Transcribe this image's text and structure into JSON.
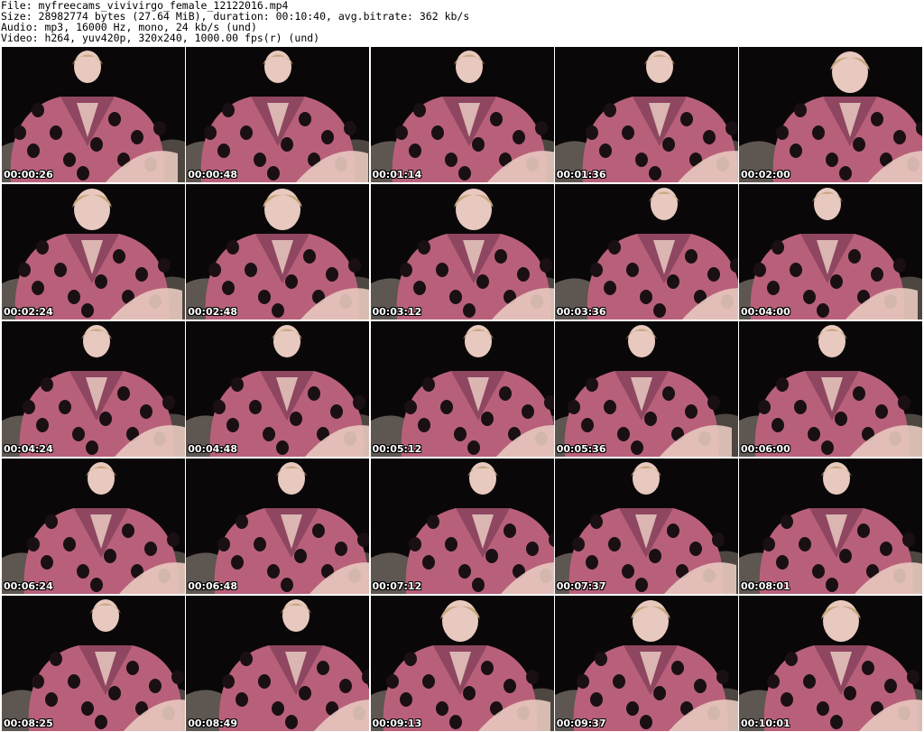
{
  "header": {
    "file_line": "File: myfreecams_vivivirgo_female_12122016.mp4",
    "size_line": "Size: 28982774 bytes (27.64 MiB), duration: 00:10:40, avg.bitrate: 362 kb/s",
    "audio_line": "Audio: mp3, 16000 Hz, mono, 24 kb/s (und)",
    "video_line": "Video: h264, yuv420p, 320x240, 1000.00 fps(r) (und)"
  },
  "colors": {
    "background": "#ffffff",
    "frame_dark": "#0a0708",
    "robe": "#b8607a",
    "robe_shadow": "#8f4660",
    "dots": "#1a1014",
    "skin": "#e8c9bf",
    "hair": "#c9a880",
    "couch": "#5e5650"
  },
  "thumbnails": [
    {
      "timestamp": "00:00:26",
      "icon": "video-frame"
    },
    {
      "timestamp": "00:00:48",
      "icon": "video-frame"
    },
    {
      "timestamp": "00:01:14",
      "icon": "video-frame"
    },
    {
      "timestamp": "00:01:36",
      "icon": "video-frame"
    },
    {
      "timestamp": "00:02:00",
      "icon": "video-frame"
    },
    {
      "timestamp": "00:02:24",
      "icon": "video-frame"
    },
    {
      "timestamp": "00:02:48",
      "icon": "video-frame"
    },
    {
      "timestamp": "00:03:12",
      "icon": "video-frame"
    },
    {
      "timestamp": "00:03:36",
      "icon": "video-frame"
    },
    {
      "timestamp": "00:04:00",
      "icon": "video-frame"
    },
    {
      "timestamp": "00:04:24",
      "icon": "video-frame"
    },
    {
      "timestamp": "00:04:48",
      "icon": "video-frame"
    },
    {
      "timestamp": "00:05:12",
      "icon": "video-frame"
    },
    {
      "timestamp": "00:05:36",
      "icon": "video-frame"
    },
    {
      "timestamp": "00:06:00",
      "icon": "video-frame"
    },
    {
      "timestamp": "00:06:24",
      "icon": "video-frame"
    },
    {
      "timestamp": "00:06:48",
      "icon": "video-frame"
    },
    {
      "timestamp": "00:07:12",
      "icon": "video-frame"
    },
    {
      "timestamp": "00:07:37",
      "icon": "video-frame"
    },
    {
      "timestamp": "00:08:01",
      "icon": "video-frame"
    },
    {
      "timestamp": "00:08:25",
      "icon": "video-frame"
    },
    {
      "timestamp": "00:08:49",
      "icon": "video-frame"
    },
    {
      "timestamp": "00:09:13",
      "icon": "video-frame"
    },
    {
      "timestamp": "00:09:37",
      "icon": "video-frame"
    },
    {
      "timestamp": "00:10:01",
      "icon": "video-frame"
    }
  ]
}
